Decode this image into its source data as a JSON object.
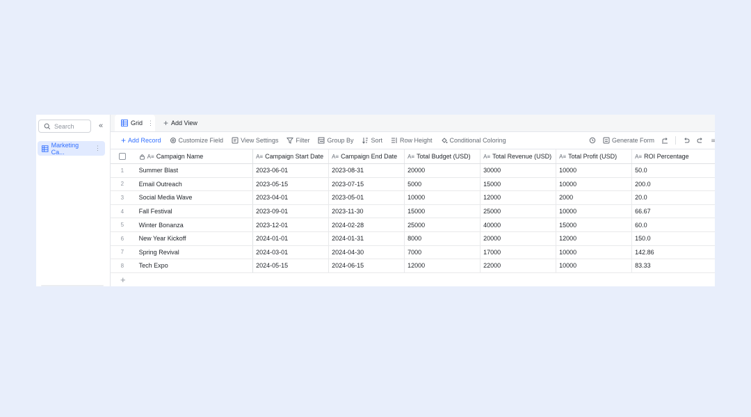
{
  "sidebar": {
    "search_placeholder": "Search",
    "collapse_icon": "double-chevron-left-icon",
    "items": [
      {
        "label": "Marketing Ca..."
      }
    ]
  },
  "tabs": {
    "active": "Grid",
    "add_view": "Add View"
  },
  "toolbar": {
    "add_record": "Add Record",
    "customize_field": "Customize Field",
    "view_settings": "View Settings",
    "filter": "Filter",
    "group_by": "Group By",
    "sort": "Sort",
    "row_height": "Row Height",
    "conditional_coloring": "Conditional Coloring",
    "generate_form": "Generate Form"
  },
  "table": {
    "columns": [
      "Campaign Name",
      "Campaign Start Date",
      "Campaign End Date",
      "Total Budget (USD)",
      "Total Revenue (USD)",
      "Total Profit (USD)",
      "ROI Percentage"
    ],
    "rows": [
      {
        "idx": "1",
        "name": "Summer Blast",
        "start": "2023-06-01",
        "end": "2023-08-31",
        "budget": "20000",
        "revenue": "30000",
        "profit": "10000",
        "roi": "50.0"
      },
      {
        "idx": "2",
        "name": "Email Outreach",
        "start": "2023-05-15",
        "end": "2023-07-15",
        "budget": "5000",
        "revenue": "15000",
        "profit": "10000",
        "roi": "200.0"
      },
      {
        "idx": "3",
        "name": "Social Media Wave",
        "start": "2023-04-01",
        "end": "2023-05-01",
        "budget": "10000",
        "revenue": "12000",
        "profit": "2000",
        "roi": "20.0"
      },
      {
        "idx": "4",
        "name": "Fall Festival",
        "start": "2023-09-01",
        "end": "2023-11-30",
        "budget": "15000",
        "revenue": "25000",
        "profit": "10000",
        "roi": "66.67"
      },
      {
        "idx": "5",
        "name": "Winter Bonanza",
        "start": "2023-12-01",
        "end": "2024-02-28",
        "budget": "25000",
        "revenue": "40000",
        "profit": "15000",
        "roi": "60.0"
      },
      {
        "idx": "6",
        "name": "New Year Kickoff",
        "start": "2024-01-01",
        "end": "2024-01-31",
        "budget": "8000",
        "revenue": "20000",
        "profit": "12000",
        "roi": "150.0"
      },
      {
        "idx": "7",
        "name": "Spring Revival",
        "start": "2024-03-01",
        "end": "2024-04-30",
        "budget": "7000",
        "revenue": "17000",
        "profit": "10000",
        "roi": "142.86"
      },
      {
        "idx": "8",
        "name": "Tech Expo",
        "start": "2024-05-15",
        "end": "2024-06-15",
        "budget": "12000",
        "revenue": "22000",
        "profit": "10000",
        "roi": "83.33"
      }
    ],
    "add_row": "+"
  },
  "colors": {
    "accent": "#3370ff",
    "background": "#e8eefb"
  }
}
